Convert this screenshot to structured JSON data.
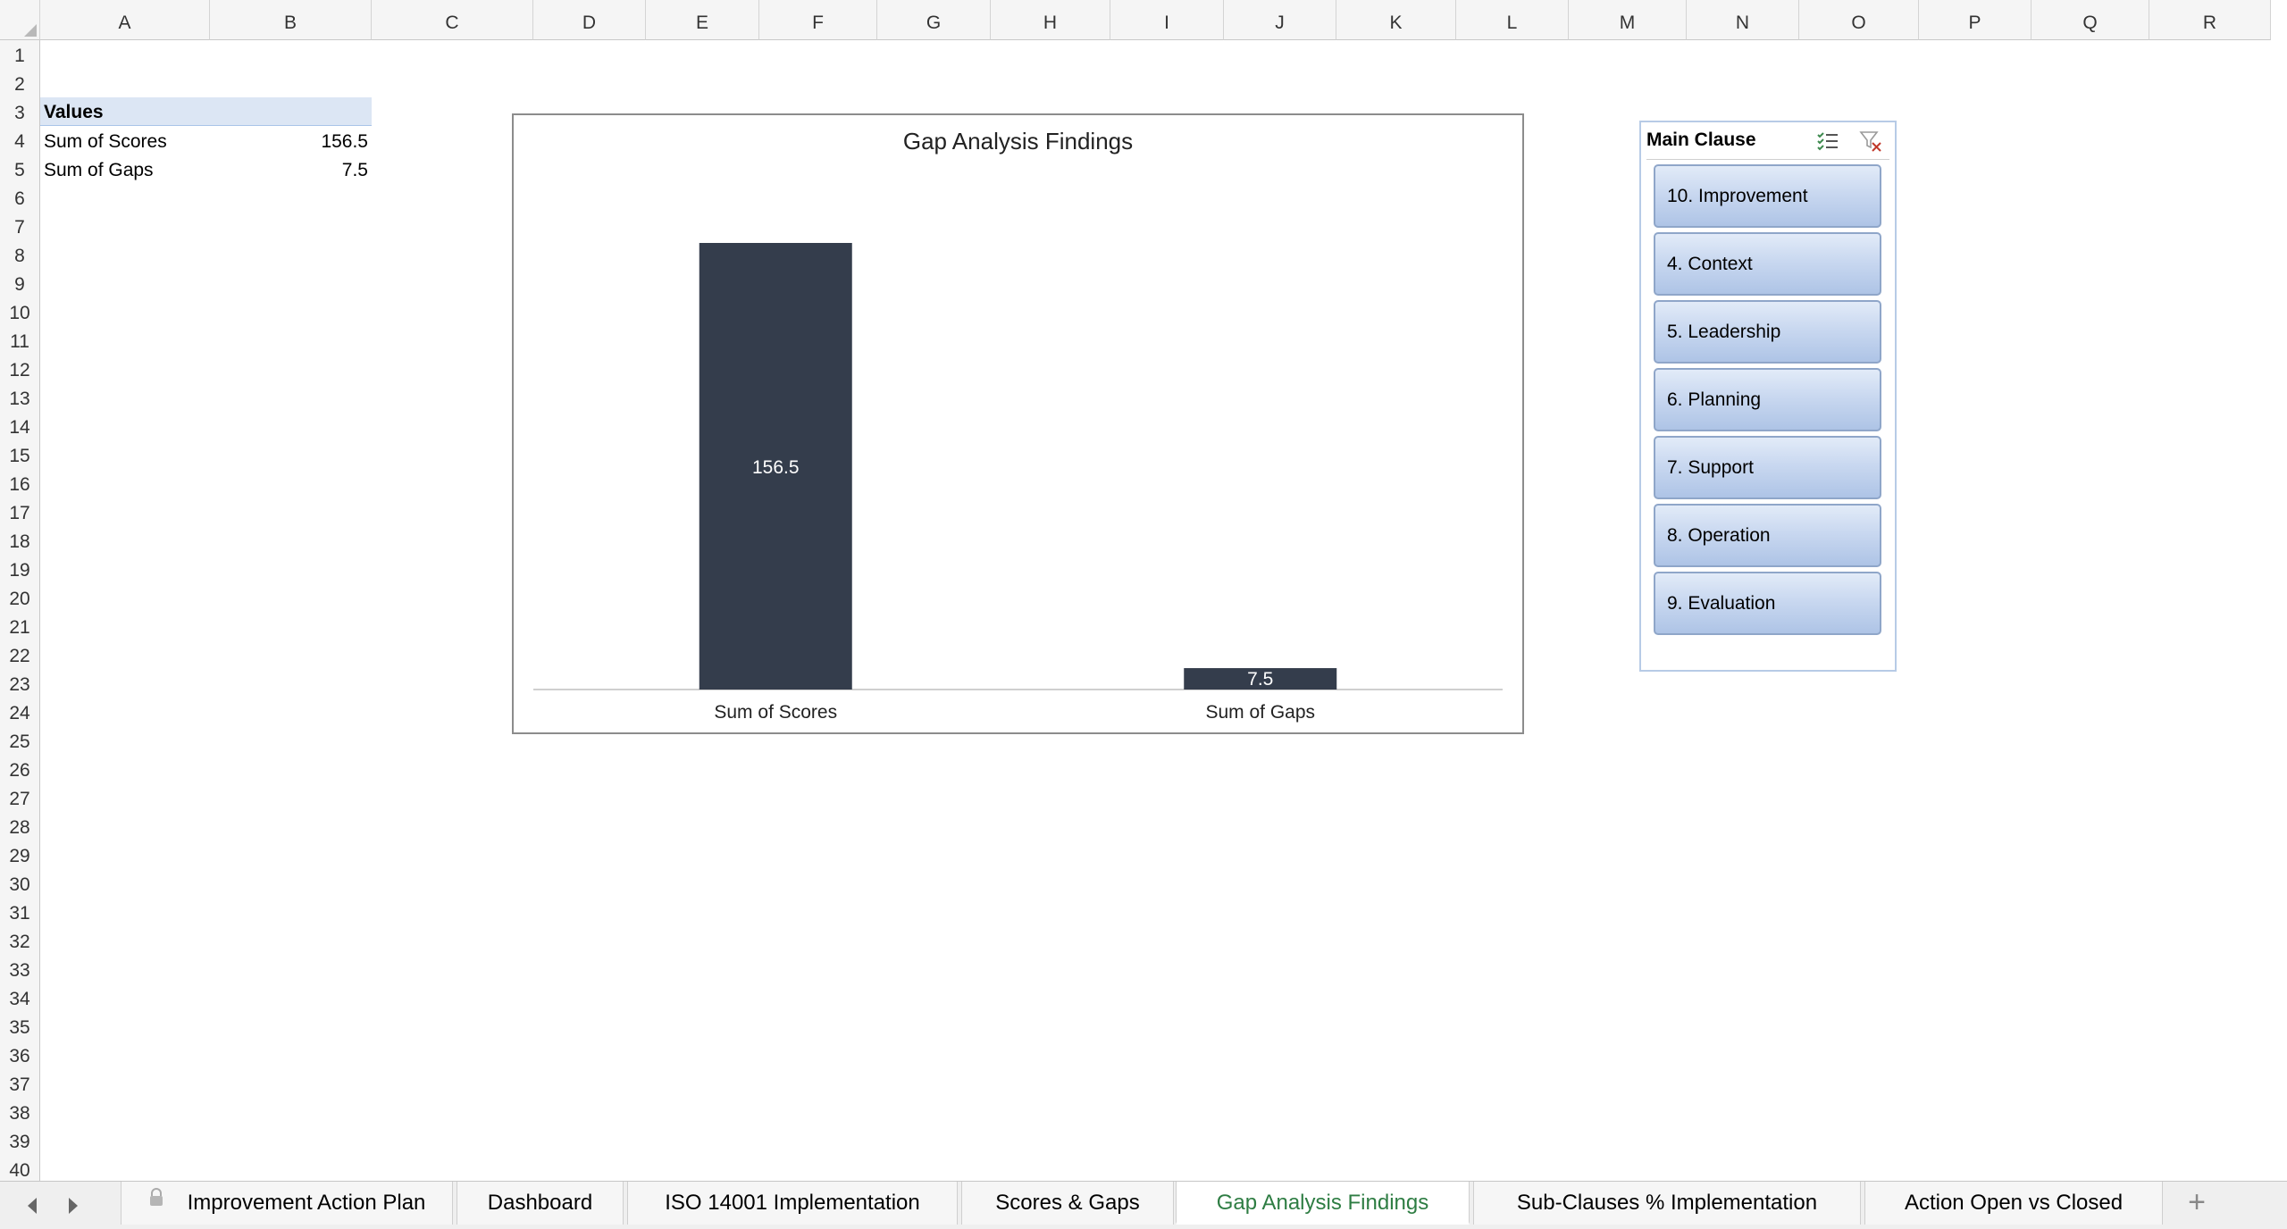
{
  "columns": [
    "A",
    "B",
    "C",
    "D",
    "E",
    "F",
    "G",
    "H",
    "I",
    "J",
    "K",
    "L",
    "M",
    "N",
    "O",
    "P",
    "Q",
    "R"
  ],
  "rows": [
    "1",
    "2",
    "3",
    "4",
    "5",
    "6",
    "7",
    "8",
    "9",
    "10",
    "11",
    "12",
    "13",
    "14",
    "15",
    "16",
    "17",
    "18",
    "19",
    "20",
    "21",
    "22",
    "23",
    "24",
    "25",
    "26",
    "27",
    "28",
    "29",
    "30",
    "31",
    "32",
    "33",
    "34",
    "35",
    "36",
    "37",
    "38",
    "39",
    "40"
  ],
  "pivot": {
    "header": "Values",
    "rows": [
      {
        "label": "Sum of Scores",
        "value": "156.5"
      },
      {
        "label": "Sum of Gaps",
        "value": "7.5"
      }
    ]
  },
  "chart_data": {
    "type": "bar",
    "title": "Gap Analysis Findings",
    "categories": [
      "Sum of Scores",
      "Sum of Gaps"
    ],
    "values": [
      156.5,
      7.5
    ],
    "data_labels": [
      "156.5",
      "7.5"
    ],
    "bar_color": "#343d4c",
    "xlabel": "",
    "ylabel": "",
    "grid": false,
    "legend": "none"
  },
  "slicer": {
    "title": "Main Clause",
    "icons": [
      "multi-select-icon",
      "clear-filter-icon"
    ],
    "items": [
      "10. Improvement",
      "4. Context",
      "5. Leadership",
      "6. Planning",
      "7. Support",
      "8. Operation",
      "9. Evaluation"
    ]
  },
  "tabs": {
    "items": [
      {
        "label": "Improvement Action Plan",
        "locked": true
      },
      {
        "label": "Dashboard"
      },
      {
        "label": "ISO 14001 Implementation"
      },
      {
        "label": "Scores & Gaps"
      },
      {
        "label": "Gap Analysis Findings",
        "active": true
      },
      {
        "label": "Sub-Clauses % Implementation"
      },
      {
        "label": "Action Open vs Closed"
      }
    ],
    "add_label": "+",
    "active_color": "#2e7d43"
  }
}
